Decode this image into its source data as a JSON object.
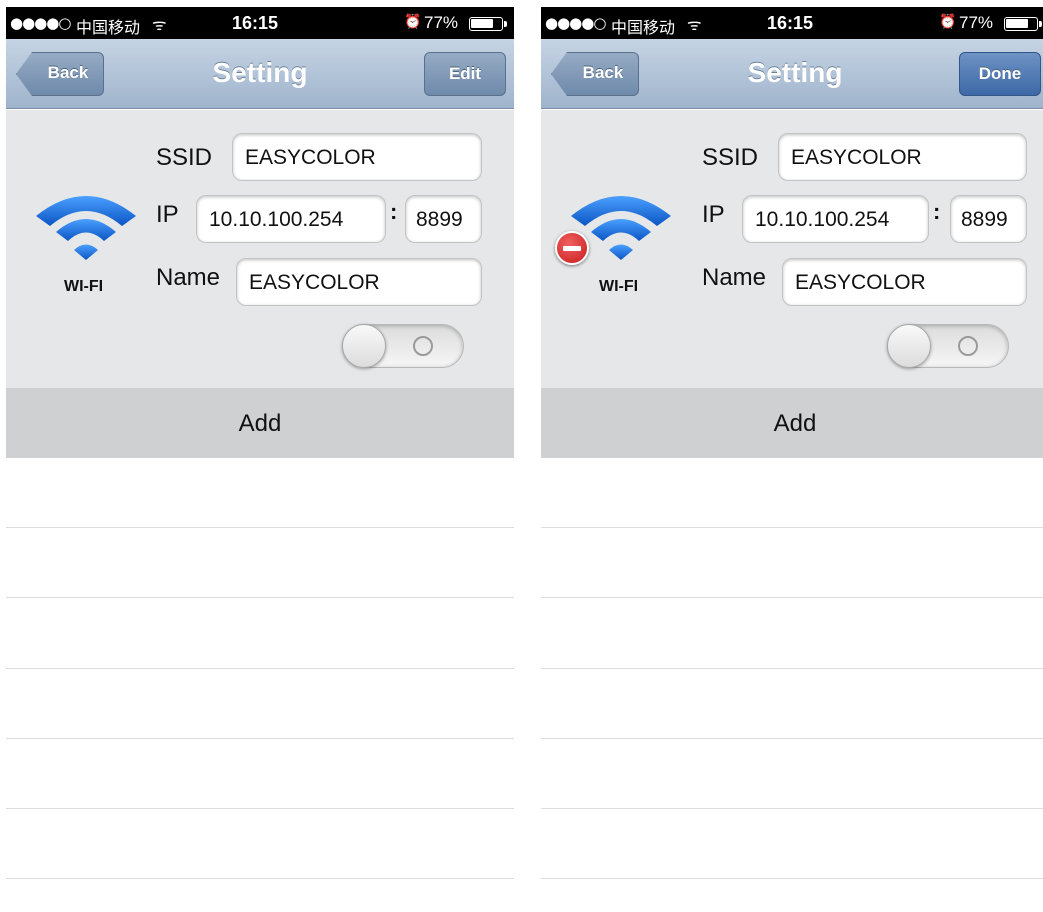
{
  "screens": [
    {
      "id": "left",
      "status": {
        "signal": "●●●●○",
        "carrier": "中国移动",
        "wifi": "ᯤ",
        "time": "16:15",
        "alarm": "⏰",
        "battery": "77%",
        "battery_level": 0.77
      },
      "nav": {
        "back": "Back",
        "title": "Setting",
        "right": "Edit"
      },
      "device": {
        "ssid_label": "SSID",
        "ssid": "EASYCOLOR",
        "ip_label": "IP",
        "ip": "10.10.100.254",
        "colon": ":",
        "port": "8899",
        "name_label": "Name",
        "name": "EASYCOLOR",
        "wifi_label": "WI-FI",
        "toggle_on": false
      },
      "add": "Add"
    },
    {
      "id": "right",
      "status": {
        "signal": "●●●●○",
        "carrier": "中国移动",
        "wifi": "ᯤ",
        "time": "16:15",
        "alarm": "⏰",
        "battery": "77%",
        "battery_level": 0.77
      },
      "nav": {
        "back": "Back",
        "title": "Setting",
        "right": "Done"
      },
      "device": {
        "ssid_label": "SSID",
        "ssid": "EASYCOLOR",
        "ip_label": "IP",
        "ip": "10.10.100.254",
        "colon": ":",
        "port": "8899",
        "name_label": "Name",
        "name": "EASYCOLOR",
        "wifi_label": "WI-FI",
        "toggle_on": false,
        "delete_visible": true
      },
      "add": "Add"
    }
  ],
  "colors": {
    "nav_top": "#c6d4e4",
    "nav_bottom": "#9fb4cc",
    "cell_bg": "#e6e7e8",
    "add_bg": "#cfd0d2",
    "wifi_blue": "#1a6fe0",
    "delete_red": "#d42a2a",
    "done_blue": "#3d69a6"
  }
}
